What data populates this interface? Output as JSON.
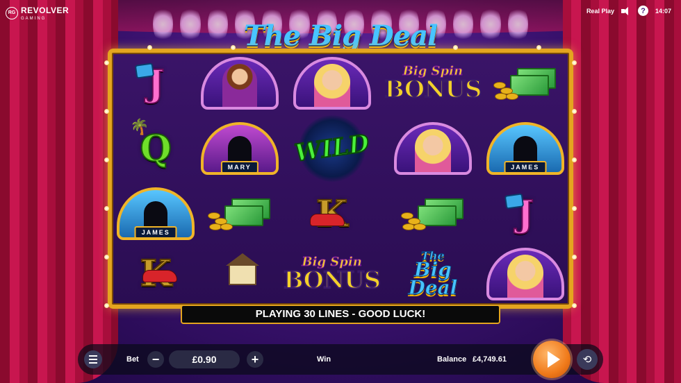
{
  "header": {
    "brand_badge": "RG",
    "brand_name": "REVOLVER",
    "brand_sub": "GAMING",
    "mode": "Real Play",
    "help_label": "?",
    "clock": "14:07"
  },
  "game": {
    "title": "The Big Deal"
  },
  "reels": {
    "row1": {
      "col2_symbol": "host",
      "col4_bonus_top": "Big Spin",
      "col4_bonus_word": "BONUS"
    },
    "row2": {
      "col2_name": "MARY",
      "col3_wild": "WILD",
      "col5_name": "JAMES"
    },
    "row3": {
      "col1_name": "JAMES"
    },
    "row4": {
      "col3_bonus_top": "Big Spin",
      "col3_bonus_word": "BONUS",
      "col4_logo_1": "The",
      "col4_logo_2": "Big",
      "col4_logo_3": "Deal"
    },
    "letters": {
      "j": "J",
      "q": "Q",
      "k": "K"
    }
  },
  "message": "PLAYING 30 LINES - GOOD LUCK!",
  "controls": {
    "bet_label": "Bet",
    "bet_value": "£0.90",
    "minus": "−",
    "plus": "+",
    "win_label": "Win",
    "balance_label": "Balance",
    "balance_value": "£4,749.61",
    "autoplay_glyph": "⟲"
  },
  "colors": {
    "frame_gold": "#e4a51f",
    "spin_orange": "#f07a1a",
    "curtain_red": "#c8164f"
  },
  "icons": [
    "speaker-icon",
    "help-icon",
    "menu-icon",
    "minus-icon",
    "plus-icon",
    "spin-icon",
    "autoplay-icon"
  ]
}
